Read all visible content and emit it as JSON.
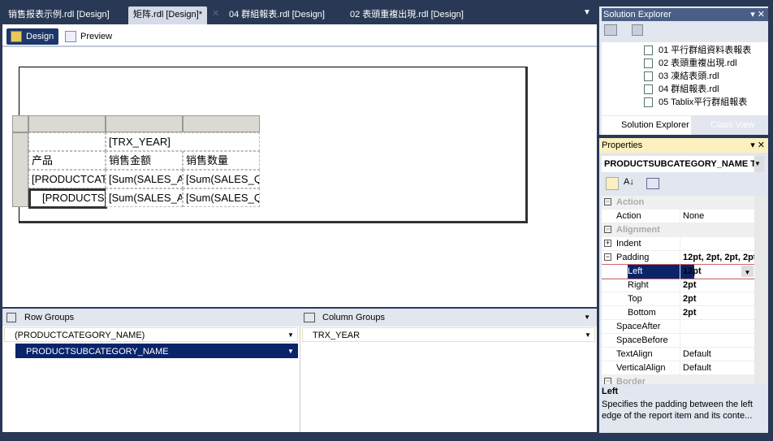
{
  "tabs": [
    {
      "label": "销售报表示例.rdl [Design]"
    },
    {
      "label": "矩阵.rdl [Design]*",
      "active": true
    },
    {
      "label": "04 群組報表.rdl [Design]"
    },
    {
      "label": "02 表頭重複出現.rdl [Design]"
    }
  ],
  "view_tabs": {
    "design": "Design",
    "preview": "Preview"
  },
  "tablix": {
    "column_header": "[TRX_YEAR]",
    "headers": [
      "产品",
      "销售金额",
      "销售数量"
    ],
    "rows": [
      [
        "[PRODUCTCAT",
        "[Sum(SALES_A",
        "[Sum(SALES_Q"
      ],
      [
        "[PRODUCTS",
        "[Sum(SALES_A",
        "[Sum(SALES_Q"
      ]
    ]
  },
  "row_groups": {
    "title": "Row Groups",
    "items": [
      "(PRODUCTCATEGORY_NAME)",
      "PRODUCTSUBCATEGORY_NAME"
    ]
  },
  "column_groups": {
    "title": "Column Groups",
    "items": [
      "TRX_YEAR"
    ]
  },
  "solution_explorer": {
    "title": "Solution Explorer",
    "files": [
      "01 平行群組資料表報表",
      "02 表頭重複出現.rdl",
      "03 凍結表頭.rdl",
      "04 群組報表.rdl",
      "05 Tablix平行群組報表"
    ],
    "tabs": [
      "Solution Explorer",
      "Class View"
    ]
  },
  "properties": {
    "title": "Properties",
    "object": "PRODUCTSUBCATEGORY_NAME T",
    "rows": [
      {
        "name": "Action",
        "cat": true
      },
      {
        "name": "Action",
        "value": "None"
      },
      {
        "name": "Alignment",
        "cat": true
      },
      {
        "name": "Indent",
        "exp": "+"
      },
      {
        "name": "Padding",
        "value": "12pt, 2pt, 2pt, 2pt",
        "exp": "-",
        "bold": true
      },
      {
        "name": "Left",
        "value": "12pt",
        "sub": true,
        "bold": true,
        "selected": true
      },
      {
        "name": "Right",
        "value": "2pt",
        "sub": true,
        "bold": true
      },
      {
        "name": "Top",
        "value": "2pt",
        "sub": true,
        "bold": true
      },
      {
        "name": "Bottom",
        "value": "2pt",
        "sub": true,
        "bold": true
      },
      {
        "name": "SpaceAfter"
      },
      {
        "name": "SpaceBefore"
      },
      {
        "name": "TextAlign",
        "value": "Default"
      },
      {
        "name": "VerticalAlign",
        "value": "Default"
      },
      {
        "name": "Border",
        "cat": true
      }
    ],
    "desc_title": "Left",
    "desc_text": "Specifies the padding between the left edge of the report item and its conte..."
  },
  "colors": {
    "frame": "#293955",
    "selection": "#0a246a",
    "accent": "#1c3769"
  }
}
